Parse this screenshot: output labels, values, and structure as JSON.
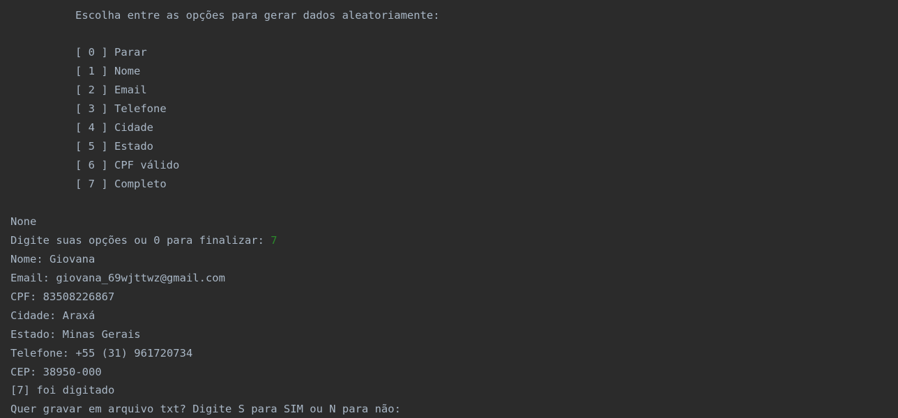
{
  "console": {
    "header": "Escolha entre as opções para gerar dados aleatoriamente:",
    "menu": [
      "[ 0 ] Parar",
      "[ 1 ] Nome",
      "[ 2 ] Email",
      "[ 3 ] Telefone",
      "[ 4 ] Cidade",
      "[ 5 ] Estado",
      "[ 6 ] CPF válido",
      "[ 7 ] Completo"
    ],
    "none_line": "None",
    "prompt": "Digite suas opções ou 0 para finalizar: ",
    "prompt_input": "7",
    "output": [
      "Nome: Giovana",
      "Email: giovana_69wjttwz@gmail.com",
      "CPF: 83508226867",
      "Cidade: Araxá",
      "Estado: Minas Gerais",
      "Telefone: +55 (31) 961720734",
      "CEP: 38950-000",
      "[7] foi digitado",
      "Quer gravar em arquivo txt? Digite S para SIM ou N para não:"
    ],
    "colors": {
      "background": "#2b2b2b",
      "text": "#a9b7c6",
      "user_input": "#2b8a2b"
    }
  }
}
